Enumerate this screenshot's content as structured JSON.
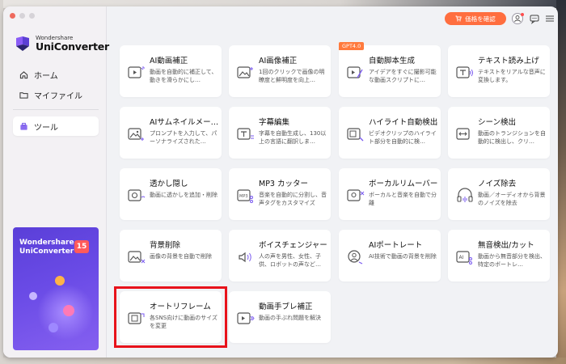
{
  "sidebar": {
    "logo_small": "Wondershare",
    "logo_big": "UniConverter",
    "nav": [
      {
        "label": "ホーム",
        "icon": "home-icon"
      },
      {
        "label": "マイファイル",
        "icon": "folder-icon"
      },
      {
        "label": "ツール",
        "icon": "toolbox-icon"
      }
    ],
    "promo": {
      "line1": "Wondershare",
      "line2": "UniConverter",
      "version": "15"
    }
  },
  "topbar": {
    "price_label": "価格を確認",
    "icons": [
      "cart-icon",
      "user-icon",
      "message-icon",
      "menu-icon"
    ]
  },
  "colors": {
    "accent": "#ff6e3f",
    "highlight": "#e8121b",
    "promo": "#6a4be6"
  },
  "tools": [
    {
      "title": "AI動画補正",
      "desc": "動画を自動的に補正して、動きを滑らかにし…",
      "icon": "ai-video-enhance-icon"
    },
    {
      "title": "AI画像補正",
      "desc": "1回のクリックで画像の明瞭度と鮮明度を向上…",
      "icon": "ai-image-enhance-icon"
    },
    {
      "title": "自動脚本生成",
      "desc": "アイデアをすぐに撮影可能な動画スクリプトに…",
      "icon": "script-icon",
      "badge": "GPT4.0"
    },
    {
      "title": "テキスト読み上げ",
      "desc": "テキストをリアルな音声に変換します。",
      "icon": "text-to-speech-icon"
    },
    {
      "title": "AIサムネイルメー…",
      "desc": "プロンプトを入力して、パーソナライズされた…",
      "icon": "thumbnail-icon"
    },
    {
      "title": "字幕編集",
      "desc": "字幕を自動生成し、130以上の言語に翻訳しま…",
      "icon": "subtitle-icon"
    },
    {
      "title": "ハイライト自動検出",
      "desc": "ビデオクリップのハイライト部分を自動的に検…",
      "icon": "highlight-detect-icon"
    },
    {
      "title": "シーン検出",
      "desc": "動画のトランジションを自動的に検出し、クリ…",
      "icon": "scene-detect-icon"
    },
    {
      "title": "透かし隠し",
      "desc": "動画に透かしを追加・削除",
      "icon": "watermark-icon"
    },
    {
      "title": "MP3 カッター",
      "desc": "音楽を自動的に分割し、音声タグをカスタマイズ",
      "icon": "mp3-cutter-icon"
    },
    {
      "title": "ボーカルリムーバー",
      "desc": "ボーカルと音楽を自動で分離",
      "icon": "vocal-remover-icon"
    },
    {
      "title": "ノイズ除去",
      "desc": "動画／オーディオから背景のノイズを除去",
      "icon": "noise-remover-icon"
    },
    {
      "title": "背景削除",
      "desc": "画像の背景を自動で削除",
      "icon": "background-remover-icon"
    },
    {
      "title": "ボイスチェンジャー",
      "desc": "人の声を男性、女性、子供、ロボットの声など…",
      "icon": "voice-changer-icon"
    },
    {
      "title": "AIポートレート",
      "desc": "AI技術で動画の背景を削除",
      "icon": "ai-portrait-icon"
    },
    {
      "title": "無音検出/カット",
      "desc": "動画から無音部分を検出、特定のボートレ…",
      "icon": "silence-detect-icon"
    },
    {
      "title": "オートリフレーム",
      "desc": "各SNS向けに動画のサイズを変更",
      "icon": "auto-reframe-icon"
    },
    {
      "title": "動画手ブレ補正",
      "desc": "動画の手ぶれ問題を解決",
      "icon": "stabilize-icon"
    }
  ]
}
